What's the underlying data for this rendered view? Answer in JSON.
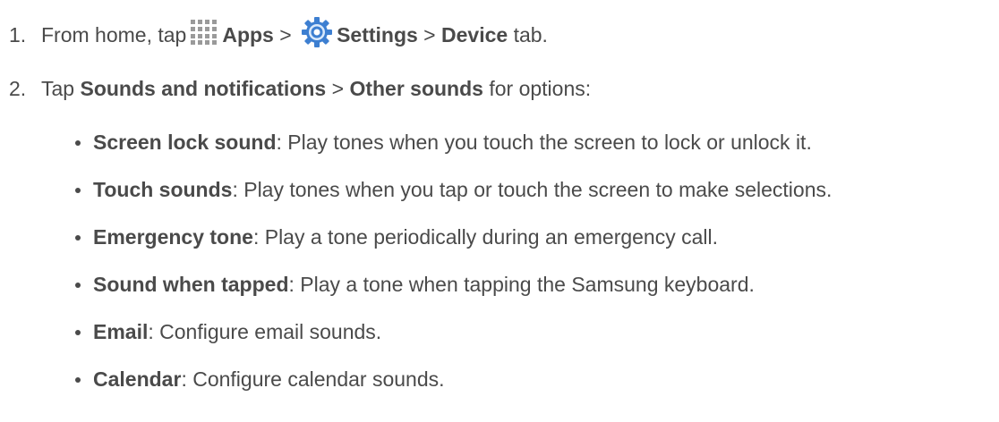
{
  "steps": [
    {
      "num": "1.",
      "t1": "From home, tap",
      "b1": "Apps",
      "t2": " > ",
      "b2": "Settings",
      "t3": " > ",
      "b3": "Device",
      "t4": " tab.",
      "icons": [
        "apps-grid-icon",
        "settings-gear-icon"
      ]
    },
    {
      "num": "2.",
      "t1": "Tap ",
      "b1": "Sounds and notifications",
      "t2": " > ",
      "b2": "Other sounds",
      "t3": " for options:"
    }
  ],
  "options": [
    {
      "term": "Screen lock sound",
      "desc": ": Play tones when you touch the screen to lock or unlock it."
    },
    {
      "term": "Touch sounds",
      "desc": ": Play tones when you tap or touch the screen to make selections."
    },
    {
      "term": "Emergency tone",
      "desc": ": Play a tone periodically during an emergency call."
    },
    {
      "term": "Sound when tapped",
      "desc": ": Play a tone when tapping the Samsung keyboard."
    },
    {
      "term": "Email",
      "desc": ": Configure email sounds."
    },
    {
      "term": "Calendar",
      "desc": ": Configure calendar sounds."
    }
  ],
  "colors": {
    "text": "#4a4a4a",
    "gear": "#3d7fd1",
    "apps_grid": "#9a9a9a"
  }
}
